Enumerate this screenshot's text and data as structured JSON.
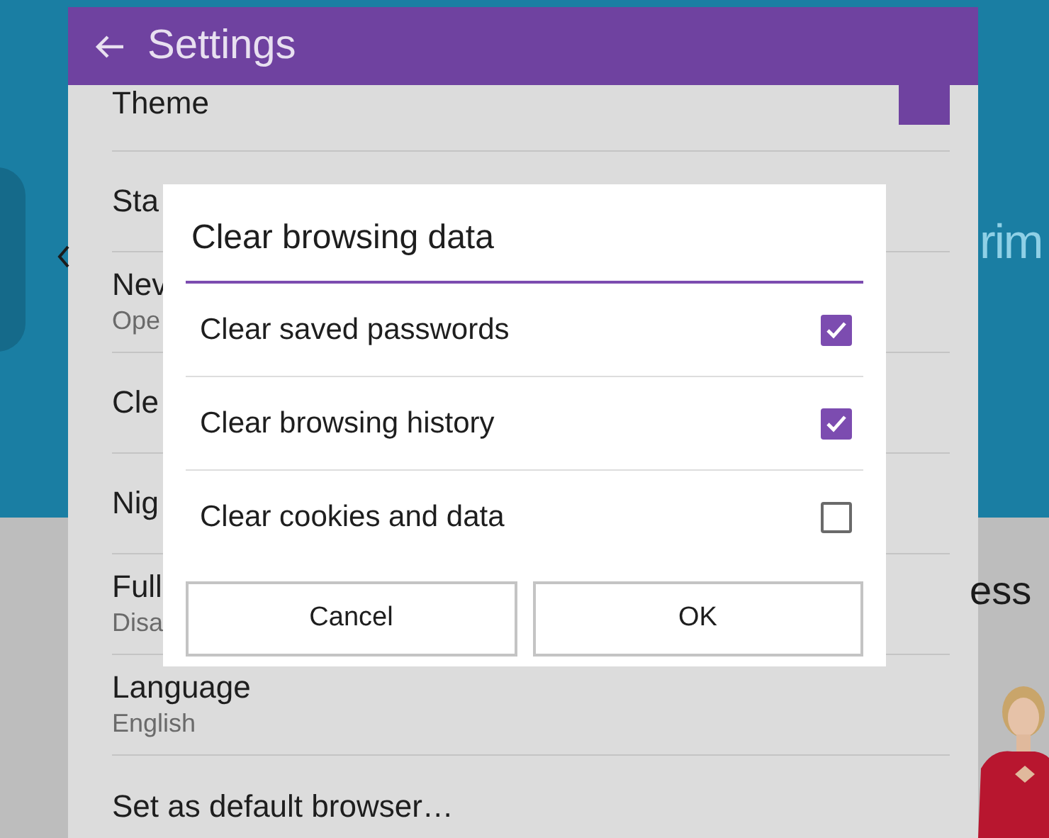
{
  "background_page": {
    "heading_fragment": "rim",
    "text_fragment": "ess"
  },
  "settings": {
    "title": "Settings",
    "items": [
      {
        "title": "Theme",
        "kind": "swatch"
      },
      {
        "title": "Sta"
      },
      {
        "title": "Nev",
        "subtitle": "Ope"
      },
      {
        "title": "Cle"
      },
      {
        "title": "Nig"
      },
      {
        "title": "Full",
        "subtitle": "Disa"
      },
      {
        "title": "Language",
        "subtitle": "English"
      },
      {
        "title": "Set as default browser…"
      }
    ]
  },
  "dialog": {
    "title": "Clear browsing data",
    "options": [
      {
        "label": "Clear saved passwords",
        "checked": true
      },
      {
        "label": "Clear browsing history",
        "checked": true
      },
      {
        "label": "Clear cookies and data",
        "checked": false
      }
    ],
    "buttons": [
      "Cancel",
      "OK"
    ]
  }
}
